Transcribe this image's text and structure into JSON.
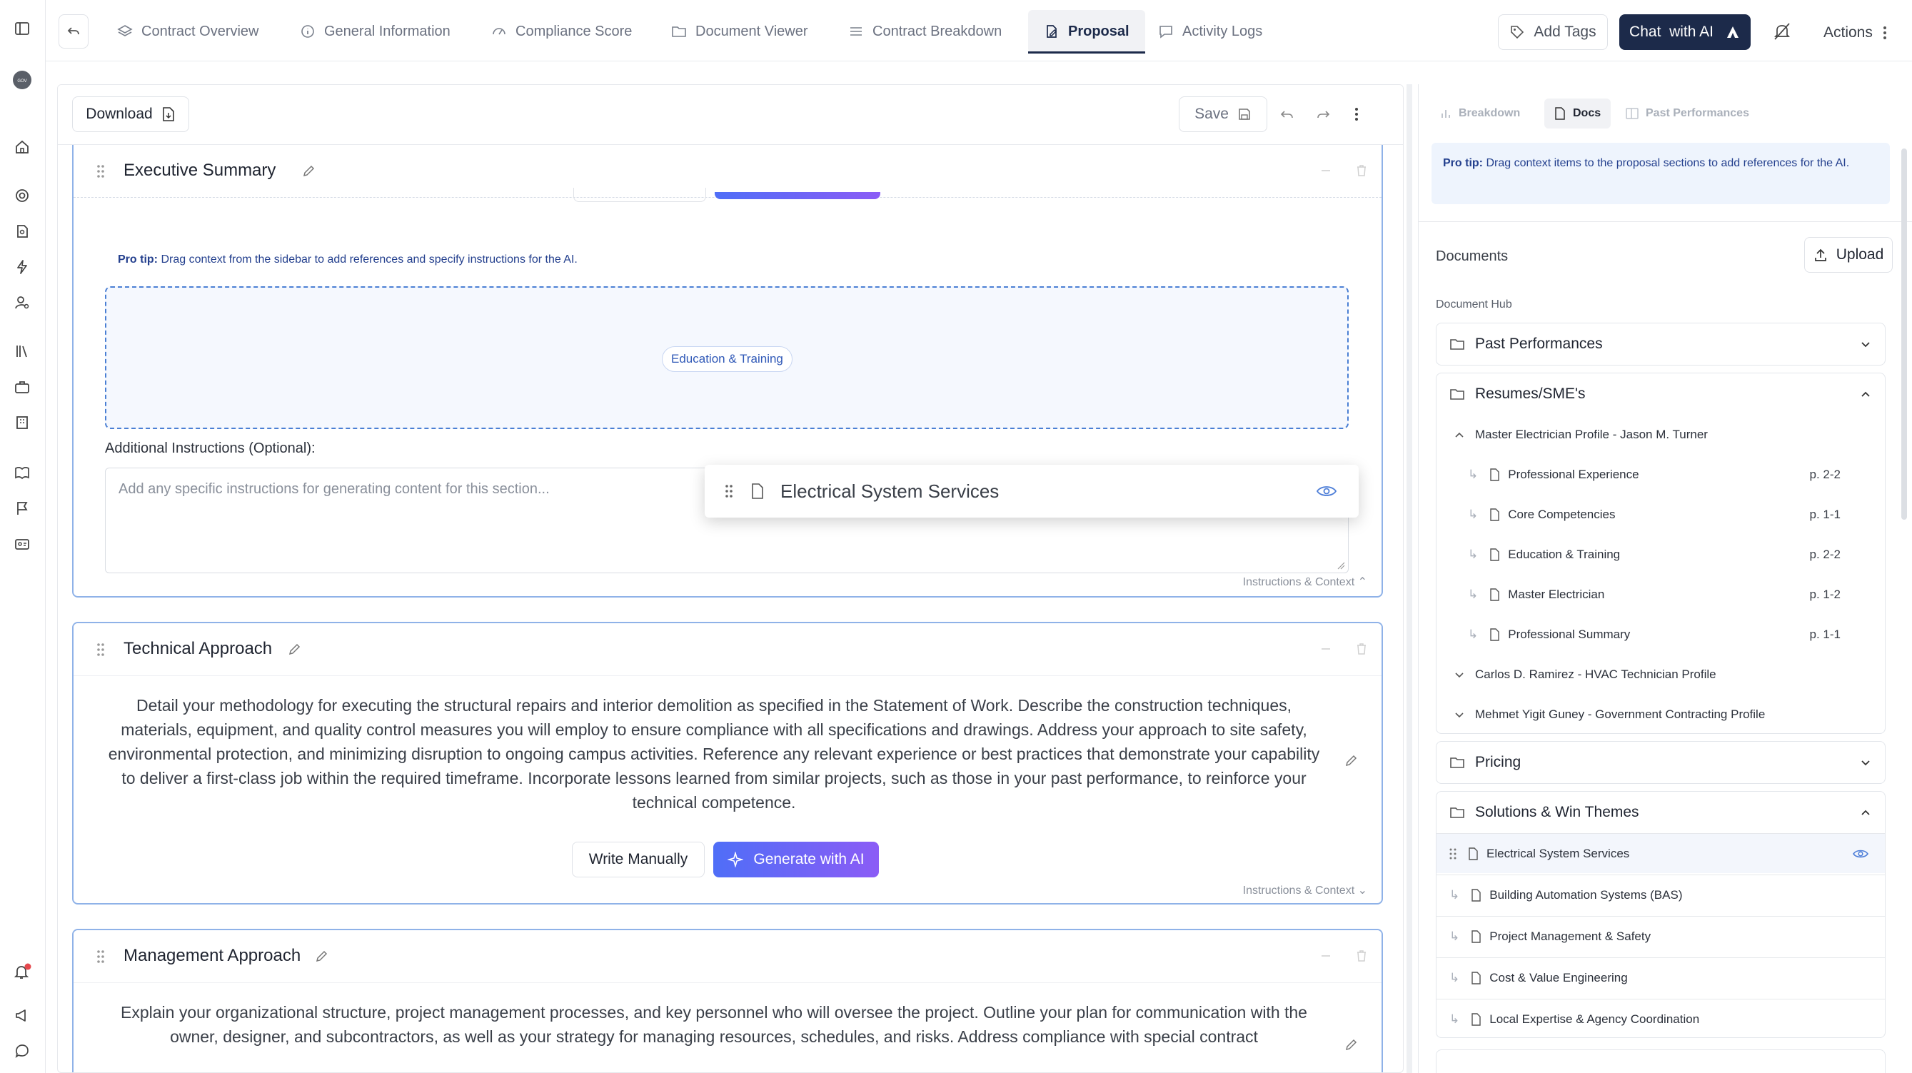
{
  "tabs": [
    {
      "label": "Contract Overview",
      "icon": "layers-icon"
    },
    {
      "label": "General Information",
      "icon": "info-icon"
    },
    {
      "label": "Compliance Score",
      "icon": "gauge-icon"
    },
    {
      "label": "Document Viewer",
      "icon": "folder-icon"
    },
    {
      "label": "Contract Breakdown",
      "icon": "list-icon"
    },
    {
      "label": "Proposal",
      "icon": "edit-doc-icon",
      "active": true
    },
    {
      "label": "Activity Logs",
      "icon": "message-icon"
    }
  ],
  "header": {
    "add_tags": "Add Tags",
    "chat_ai": "Chat  with AI",
    "actions": "Actions"
  },
  "toolbar": {
    "download": "Download",
    "save": "Save"
  },
  "sections": {
    "executive": {
      "title": "Executive Summary",
      "pro_tip_label": "Pro tip:",
      "pro_tip_text": "Drag context from the sidebar to add references and specify instructions for the AI.",
      "chip": "Education & Training",
      "instructions_label": "Additional Instructions (Optional):",
      "instructions_placeholder": "Add any specific instructions for generating content for this section...",
      "toggle": "Instructions & Context"
    },
    "technical": {
      "title": "Technical Approach",
      "prompt": "Detail your methodology for executing the structural repairs and interior demolition as specified in the Statement of Work. Describe the construction techniques, materials, equipment, and quality control measures you will employ to ensure compliance with all specifications and drawings. Address your approach to site safety, environmental protection, and minimizing disruption to ongoing campus activities. Reference any relevant experience or best practices that demonstrate your capability to deliver a first-class job within the required timeframe. Incorporate lessons learned from similar projects, such as those in your past performance, to reinforce your technical competence.",
      "write_manually": "Write Manually",
      "generate_ai": "Generate with AI",
      "toggle": "Instructions & Context"
    },
    "management": {
      "title": "Management Approach",
      "prompt": "Explain your organizational structure, project management processes, and key personnel who will oversee the project. Outline your plan for communication with the owner, designer, and subcontractors, as well as your strategy for managing resources, schedules, and risks. Address compliance with special contract"
    }
  },
  "drag_card": {
    "label": "Electrical System Services"
  },
  "panel": {
    "tabs": [
      "Breakdown",
      "Docs",
      "Past Performances"
    ],
    "active_tab": "Docs",
    "pro_tip_label": "Pro tip:",
    "pro_tip_text": "Drag context items to the proposal sections to add references for the AI.",
    "documents_label": "Documents",
    "upload": "Upload",
    "hub_label": "Document Hub",
    "groups": {
      "past_performances": "Past Performances",
      "resumes": "Resumes/SME's",
      "pricing": "Pricing",
      "solutions": "Solutions & Win Themes"
    },
    "resume_parent": "Master Electrician Profile - Jason M. Turner",
    "resume_children": [
      {
        "label": "Professional Experience",
        "page": "p. 2-2"
      },
      {
        "label": "Core Competencies",
        "page": "p. 1-1"
      },
      {
        "label": "Education & Training",
        "page": "p. 2-2"
      },
      {
        "label": "Master Electrician",
        "page": "p. 1-2"
      },
      {
        "label": "Professional Summary",
        "page": "p. 1-1"
      }
    ],
    "resume_others": [
      "Carlos D. Ramirez - HVAC Technician Profile",
      "Mehmet Yigit Guney - Government Contracting Profile"
    ],
    "solutions_items": [
      "Electrical System Services",
      "Building Automation Systems (BAS)",
      "Project Management & Safety",
      "Cost & Value Engineering",
      "Local Expertise & Agency Coordination"
    ]
  },
  "colors": {
    "navy": "#1c2a4a",
    "accent": "#4f6ef7",
    "accent2": "#8b5cf6",
    "notification": "#e5484d"
  }
}
